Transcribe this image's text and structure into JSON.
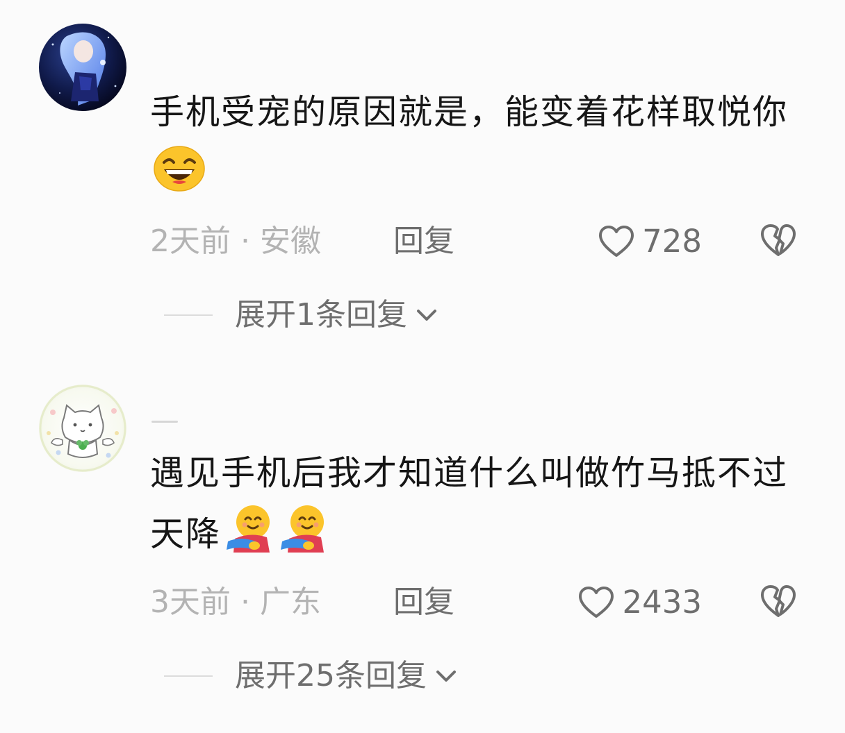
{
  "comments": [
    {
      "avatar": "anime-girl-avatar",
      "text": "手机受宠的原因就是，能变着花样取悦你",
      "emojis": [
        "grinning-squinting-face-emoji"
      ],
      "time": "2天前",
      "separator": "·",
      "location": "安徽",
      "reply_label": "回复",
      "likes": "728",
      "expand_label": "展开1条回复"
    },
    {
      "avatar": "white-cat-avatar",
      "text": "遇见手机后我才知道什么叫做竹马抵不过天降",
      "emojis": [
        "hugging-face-emoji",
        "hugging-face-emoji"
      ],
      "time": "3天前",
      "separator": "·",
      "location": "广东",
      "reply_label": "回复",
      "likes": "2433",
      "expand_label": "展开25条回复"
    }
  ],
  "colors": {
    "background": "#fbfbfb",
    "text": "#161616",
    "meta": "#b3b3b3",
    "action": "#6e6e6e",
    "emoji_yellow": "#fbc42b"
  }
}
